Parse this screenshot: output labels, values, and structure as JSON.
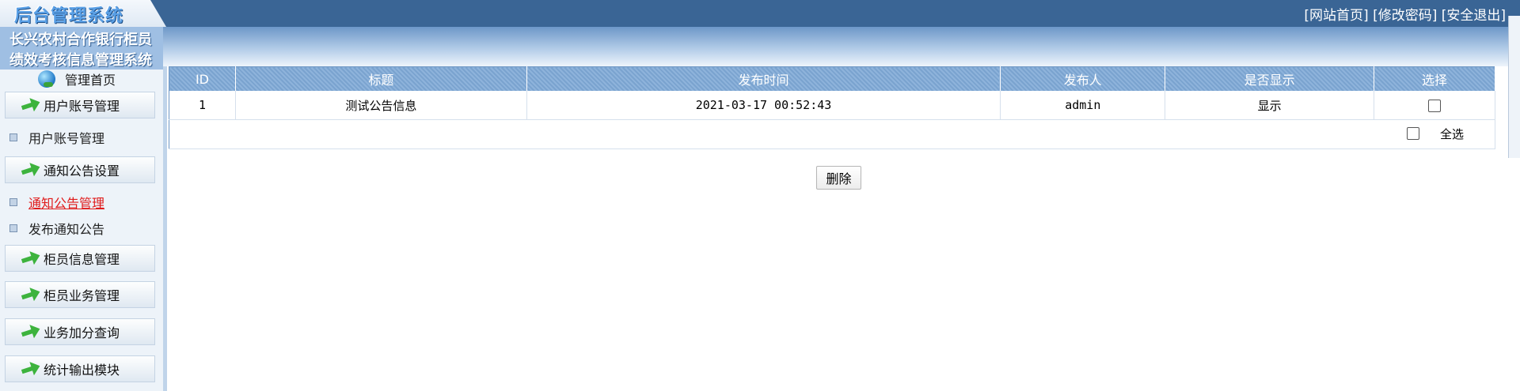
{
  "header": {
    "logo_text": "后台管理系统",
    "links": [
      "[网站首页]",
      "[修改密码]",
      "[安全退出]"
    ]
  },
  "sidebar": {
    "system_title_line1": "长兴农村合作银行柜员",
    "system_title_line2": "绩效考核信息管理系统",
    "home_label": "管理首页",
    "groups": [
      {
        "label": "用户账号管理",
        "items": [
          {
            "label": "用户账号管理",
            "active": false
          }
        ]
      },
      {
        "label": "通知公告设置",
        "items": [
          {
            "label": "通知公告管理",
            "active": true
          },
          {
            "label": "发布通知公告",
            "active": false
          }
        ]
      },
      {
        "label": "柜员信息管理",
        "items": []
      },
      {
        "label": "柜员业务管理",
        "items": []
      },
      {
        "label": "业务加分查询",
        "items": []
      },
      {
        "label": "统计输出模块",
        "items": []
      }
    ]
  },
  "table": {
    "columns": [
      "ID",
      "标题",
      "发布时间",
      "发布人",
      "是否显示",
      "选择"
    ],
    "rows": [
      [
        "1",
        "测试公告信息",
        "2021-03-17 00:52:43",
        "admin",
        "显示"
      ]
    ],
    "select_all_label": "全选"
  },
  "actions": {
    "delete_label": "删除"
  },
  "colors": {
    "topbar": "#3a6595",
    "table_header": "#7aa3cf",
    "active_link": "#e01a1a"
  }
}
